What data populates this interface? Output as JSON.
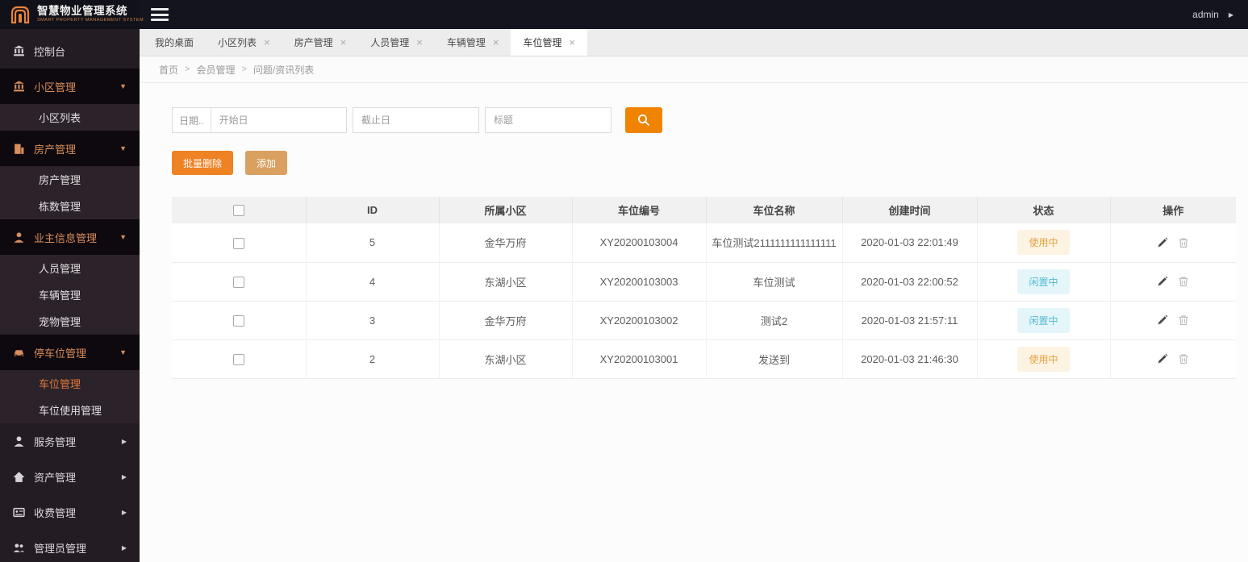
{
  "glyphs": {
    "close": "×",
    "caret_down": "▼",
    "caret_right": "▶",
    "breadcrumb_sep": ">",
    "user_caret": "▶"
  },
  "colors": {
    "accent_orange": "#F08300",
    "button_delete": "#EF8222",
    "button_add": "#D9A05F",
    "sidebar_bg": "#241C23",
    "sidebar_active_text": "#E0793C",
    "badge_inuse_text": "#E6A23C",
    "badge_inuse_bg": "#FDF3E3",
    "badge_idle_text": "#54B9CE",
    "badge_idle_bg": "#E4F6FA"
  },
  "icons": {
    "logo": "arch-gate-icon",
    "menu": "hamburger-icon",
    "console": "bank-icon",
    "community": "bank-icon",
    "property": "building-icon",
    "owner": "user-icon",
    "parking": "car-icon",
    "service": "user-icon",
    "asset": "home-icon",
    "fee": "card-icon",
    "admin": "users-icon",
    "search": "magnifier-icon",
    "edit": "pencil-icon",
    "delete": "trash-icon"
  },
  "header": {
    "logo_title": "智慧物业管理系统",
    "logo_subtitle": "SMART PROPERTY MANAGEMENT SYSTEM",
    "username": "admin"
  },
  "sidebar": {
    "console": "控制台",
    "groups": [
      {
        "label": "小区管理",
        "expanded": true,
        "children": [
          "小区列表"
        ]
      },
      {
        "label": "房产管理",
        "expanded": true,
        "children": [
          "房产管理",
          "栋数管理"
        ]
      },
      {
        "label": "业主信息管理",
        "expanded": true,
        "children": [
          "人员管理",
          "车辆管理",
          "宠物管理"
        ]
      },
      {
        "label": "停车位管理",
        "expanded": true,
        "children": [
          "车位管理",
          "车位使用管理"
        ]
      },
      {
        "label": "服务管理",
        "expanded": false,
        "children": []
      },
      {
        "label": "资产管理",
        "expanded": false,
        "children": []
      },
      {
        "label": "收费管理",
        "expanded": false,
        "children": []
      },
      {
        "label": "管理员管理",
        "expanded": false,
        "children": []
      }
    ],
    "active_item": "车位管理"
  },
  "tabs": [
    {
      "label": "我的桌面",
      "closable": false,
      "active": false
    },
    {
      "label": "小区列表",
      "closable": true,
      "active": false
    },
    {
      "label": "房产管理",
      "closable": true,
      "active": false
    },
    {
      "label": "人员管理",
      "closable": true,
      "active": false
    },
    {
      "label": "车辆管理",
      "closable": true,
      "active": false
    },
    {
      "label": "车位管理",
      "closable": true,
      "active": true
    }
  ],
  "breadcrumb": [
    "首页",
    "会员管理",
    "问题/资讯列表"
  ],
  "filters": {
    "date_label": "日期..",
    "start_placeholder": "开始日",
    "end_placeholder": "截止日",
    "title_placeholder": "标题"
  },
  "actions": {
    "batch_delete": "批量删除",
    "add": "添加"
  },
  "table": {
    "columns": [
      "ID",
      "所属小区",
      "车位编号",
      "车位名称",
      "创建时间",
      "状态",
      "操作"
    ],
    "rows": [
      {
        "id": "5",
        "community": "金华万府",
        "code": "XY20200103004",
        "name": "车位测试2111111111111111",
        "created": "2020-01-03 22:01:49",
        "status": "使用中",
        "status_type": "inuse"
      },
      {
        "id": "4",
        "community": "东湖小区",
        "code": "XY20200103003",
        "name": "车位测试",
        "created": "2020-01-03 22:00:52",
        "status": "闲置中",
        "status_type": "idle"
      },
      {
        "id": "3",
        "community": "金华万府",
        "code": "XY20200103002",
        "name": "测试2",
        "created": "2020-01-03 21:57:11",
        "status": "闲置中",
        "status_type": "idle"
      },
      {
        "id": "2",
        "community": "东湖小区",
        "code": "XY20200103001",
        "name": "发送到",
        "created": "2020-01-03 21:46:30",
        "status": "使用中",
        "status_type": "inuse"
      }
    ]
  }
}
